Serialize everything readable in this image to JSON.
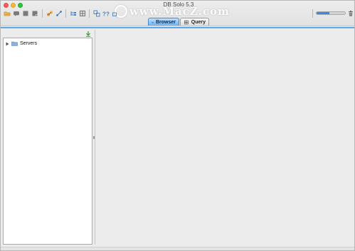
{
  "window": {
    "title": "DB Solo  5.3"
  },
  "watermark": {
    "text": "www.MacZ.com"
  },
  "toolbar": {
    "buttons": [
      {
        "name": "open-folder-icon",
        "color": "#e2a43a"
      },
      {
        "name": "speech-bubble-icon",
        "color": "#7a7a7a"
      },
      {
        "name": "stop-icon",
        "color": "#7a7a7a"
      },
      {
        "name": "save-icon",
        "color": "#7a7a7a"
      },
      {
        "name": "connect-icon",
        "color": "#d88a25"
      },
      {
        "name": "disconnect-icon",
        "color": "#4a7fc0"
      },
      {
        "name": "browse-tree-icon",
        "color": "#4a7fc0"
      },
      {
        "name": "grid-icon",
        "color": "#555555"
      },
      {
        "name": "compare-icon",
        "color": "#4a7fc0"
      },
      {
        "name": "help-icon",
        "color": "#4a7fc0"
      },
      {
        "name": "schema-icon",
        "color": "#4a7fc0"
      },
      {
        "name": "trash-icon",
        "color": "#6d6d6d"
      }
    ],
    "zoom_level": 0.45
  },
  "tabs": [
    {
      "label": "Browser",
      "active": true
    },
    {
      "label": "Query",
      "active": false
    }
  ],
  "navigator": {
    "items": [
      {
        "label": "Servers",
        "expanded": false
      }
    ]
  },
  "colors": {
    "accent": "#5aa8ec",
    "active_tab": "#6cb2f1",
    "folder": "#8fb1db"
  }
}
